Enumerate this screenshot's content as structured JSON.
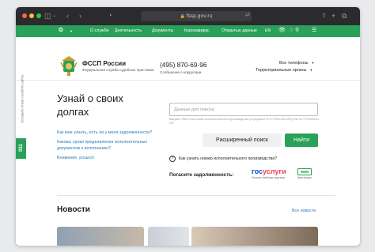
{
  "browser": {
    "url": "fssp.gov.ru",
    "colors": {
      "close": "#ff5f57",
      "minimize": "#febc2e",
      "maximize": "#28c840"
    }
  },
  "nav": {
    "items": [
      "О службе",
      "Деятельность",
      "Документы",
      "Коронавирус",
      "Открытые данные",
      "EN"
    ],
    "icons": [
      "eye-icon",
      "bell-icon",
      "search-icon",
      "menu-icon"
    ]
  },
  "header": {
    "org_name": "ФССП России",
    "org_subtitle": "Федеральная служба судебных приставов",
    "phone": "(495) 870-69-96",
    "phone_subtitle": "Сообщение о коррупции",
    "dropdown_phones": "Все телефоны",
    "dropdown_regions": "Территориальные органы"
  },
  "side": {
    "label": "Оставьте отзыв о работе сайта",
    "badge": "011"
  },
  "hero": {
    "title": "Узнай о своих долгах",
    "questions": [
      "Как мне узнать, есть ли у меня задолженности?",
      "Каковы сроки предъявления исполнительных документов к исполнению?",
      "Внимание, розыск!"
    ],
    "search_placeholder": "Данные для поиска",
    "search_hint": "Введите ФИО или номер исполнительного производства (в формате N-/YY/DDDDD-ИП) или N-/YY/DDDDD-ИП",
    "advanced_button": "Расширенный поиск",
    "find_button": "Найти",
    "help_text": "Как узнать номер исполнительного производства?",
    "pay_label": "Погасите задолженность:",
    "gosuslugi_logo": "госуслуги",
    "gosuslugi_sub": "Оплата любыми картами",
    "kv_sub": "Квитанция"
  },
  "news": {
    "title": "Новости",
    "all_link": "Все новости"
  },
  "theme": {
    "green": "#2aa158",
    "link_blue": "#2a7bbf"
  }
}
